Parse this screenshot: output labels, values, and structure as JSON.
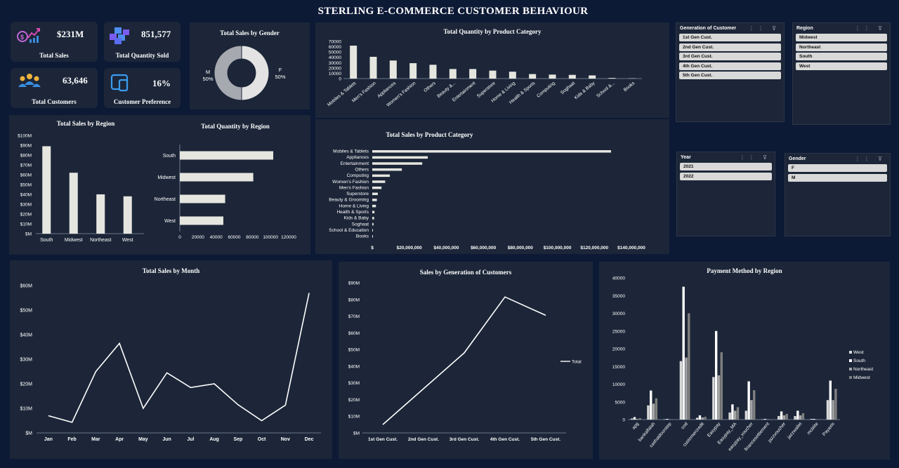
{
  "dashboard_title": "STERLING E-COMMERCE CUSTOMER BEHAVIOUR",
  "kpis": {
    "total_sales": {
      "value": "$231M",
      "label": "Total Sales",
      "icon": "sales-growth-icon"
    },
    "total_quantity": {
      "value": "851,577",
      "label": "Total Quantity Sold",
      "icon": "boxes-icon"
    },
    "total_customers": {
      "value": "63,646",
      "label": "Total Customers",
      "icon": "people-icon"
    },
    "customer_preference": {
      "value": "16%",
      "label": "Customer Preference",
      "icon": "devices-icon"
    }
  },
  "colors": {
    "background": "#0d1a36",
    "panel": "#1c2638",
    "bar": "#e6e6e0",
    "line": "#ffffff",
    "west": "#d9d9d9",
    "south": "#ffffff",
    "northeast": "#a6a6a6",
    "midwest": "#7f7f7f",
    "female": "#e3e3e3",
    "male": "#a7a9b0"
  },
  "slicers": {
    "generation": {
      "title": "Generation of Customer",
      "items": [
        "1st Gen Cust.",
        "2nd Gen Cust.",
        "3rd Gen Cust.",
        "4th Gen Cust.",
        "5th Gen Cust."
      ]
    },
    "region": {
      "title": "Region",
      "items": [
        "Midwest",
        "Northeast",
        "South",
        "West"
      ]
    },
    "year": {
      "title": "Year",
      "items": [
        "2021",
        "2022"
      ]
    },
    "gender": {
      "title": "Gender",
      "items": [
        "F",
        "M"
      ]
    }
  },
  "chart_data": [
    {
      "id": "gender",
      "type": "pie",
      "title": "Total Sales by Gender",
      "categories": [
        "F",
        "M"
      ],
      "values": [
        50,
        50
      ],
      "value_labels": [
        "50%",
        "50%"
      ]
    },
    {
      "id": "qty_category",
      "type": "bar",
      "title": "Total Quantity by Product Category",
      "categories": [
        "Mobiles & Tablets",
        "Men's Fashion",
        "Appliances",
        "Women's Fashion",
        "Others",
        "Beauty &...",
        "Entertainment",
        "Superstore",
        "Home & Living",
        "Health & Sports",
        "Computing",
        "Soghaat",
        "Kids & Baby",
        "School &...",
        "Books"
      ],
      "values": [
        62000,
        41000,
        34000,
        29000,
        26000,
        18000,
        18000,
        15000,
        13000,
        8500,
        7500,
        7000,
        6000,
        1200,
        500
      ],
      "yticks": [
        "70000",
        "60000",
        "50000",
        "40000",
        "30000",
        "20000",
        "10000",
        "0"
      ],
      "ylim": [
        0,
        70000
      ]
    },
    {
      "id": "sales_category",
      "type": "bar",
      "orientation": "horizontal",
      "title": "Total Sales by Product Category",
      "categories": [
        "Mobiles & Tablets",
        "Appliances",
        "Entertainment",
        "Others",
        "Computing",
        "Women's Fashion",
        "Men's Fashion",
        "Superstore",
        "Beauty & Grooming",
        "Home & Living",
        "Health & Sports",
        "Kids & Baby",
        "Soghaat",
        "School & Education",
        "Books"
      ],
      "values": [
        129000000,
        30000000,
        27000000,
        16000000,
        9500000,
        7000000,
        5000000,
        3000000,
        2500000,
        2000000,
        1200000,
        1000000,
        700000,
        200000,
        100000
      ],
      "xticks": [
        "$",
        "$20,000,000",
        "$40,000,000",
        "$60,000,000",
        "$80,000,000",
        "$100,000,000",
        "$120,000,000",
        "$140,000,000"
      ],
      "xlim": [
        0,
        140000000
      ]
    },
    {
      "id": "sales_region",
      "type": "bar",
      "title": "Total Sales by Region",
      "categories": [
        "South",
        "Midwest",
        "Northeast",
        "West"
      ],
      "values": [
        89000000,
        62000000,
        40000000,
        38000000
      ],
      "yticks": [
        "$100M",
        "$90M",
        "$80M",
        "$70M",
        "$60M",
        "$50M",
        "$40M",
        "$30M",
        "$20M",
        "$10M",
        "$M"
      ],
      "ylim": [
        0,
        100000000
      ]
    },
    {
      "id": "qty_region",
      "type": "bar",
      "orientation": "horizontal",
      "title": "Total Quantity by Region",
      "categories": [
        "South",
        "Midwest",
        "Northeast",
        "West"
      ],
      "values": [
        103000,
        81000,
        50000,
        48000
      ],
      "xticks": [
        "0",
        "20000",
        "40000",
        "60000",
        "80000",
        "100000",
        "120000"
      ],
      "xlim": [
        0,
        120000
      ]
    },
    {
      "id": "sales_month",
      "type": "line",
      "title": "Total Sales by Month",
      "categories": [
        "Jan",
        "Feb",
        "Mar",
        "Apr",
        "May",
        "Jun",
        "Jul",
        "Aug",
        "Sep",
        "Oct",
        "Nov",
        "Dec"
      ],
      "values": [
        7000000,
        4300000,
        25000000,
        36500000,
        10000000,
        24500000,
        18500000,
        20000000,
        11500000,
        5000000,
        11300000,
        57000000
      ],
      "yticks": [
        "$60M",
        "$50M",
        "$40M",
        "$30M",
        "$20M",
        "$10M",
        "$M"
      ],
      "ylim": [
        0,
        60000000
      ]
    },
    {
      "id": "sales_generation",
      "type": "line",
      "title": "Sales by Generation of Customers",
      "categories": [
        "1st Gen Cust.",
        "2nd Gen Cust.",
        "3rd Gen Cust.",
        "4th Gen Cust.",
        "5th Gen Cust."
      ],
      "series": [
        {
          "name": "Total",
          "values": [
            5000000,
            26500000,
            48000000,
            81500000,
            70500000
          ]
        }
      ],
      "yticks": [
        "$90M",
        "$80M",
        "$70M",
        "$60M",
        "$50M",
        "$40M",
        "$30M",
        "$20M",
        "$10M",
        "$M"
      ],
      "ylim": [
        0,
        90000000
      ]
    },
    {
      "id": "payment_region",
      "type": "bar",
      "title": "Payment Method by Region",
      "categories": [
        "apg",
        "bankalfalah",
        "cashatdoorstep",
        "cod",
        "customercredit",
        "Easypay",
        "Easypay_MA",
        "easypay_voucher",
        "financesettlement",
        "jazzvoucher",
        "jazzwallet",
        "mcblite",
        "Payaxis"
      ],
      "series": [
        {
          "name": "West",
          "values": [
            300,
            4000,
            100,
            16500,
            500,
            12000,
            2000,
            2500,
            100,
            1000,
            1000,
            200,
            5500
          ]
        },
        {
          "name": "South",
          "values": [
            700,
            8200,
            200,
            37500,
            1200,
            25000,
            4300,
            10800,
            200,
            2300,
            2500,
            200,
            11000
          ]
        },
        {
          "name": "Northeast",
          "values": [
            200,
            4500,
            100,
            17500,
            600,
            12500,
            2500,
            5500,
            100,
            1200,
            1200,
            100,
            5500
          ]
        },
        {
          "name": "Midwest",
          "values": [
            400,
            6000,
            100,
            30000,
            800,
            19000,
            3500,
            8300,
            100,
            1600,
            1800,
            100,
            8700
          ]
        }
      ],
      "yticks": [
        "40000",
        "35000",
        "30000",
        "25000",
        "20000",
        "15000",
        "10000",
        "5000",
        "0"
      ],
      "ylim": [
        0,
        40000
      ]
    }
  ]
}
